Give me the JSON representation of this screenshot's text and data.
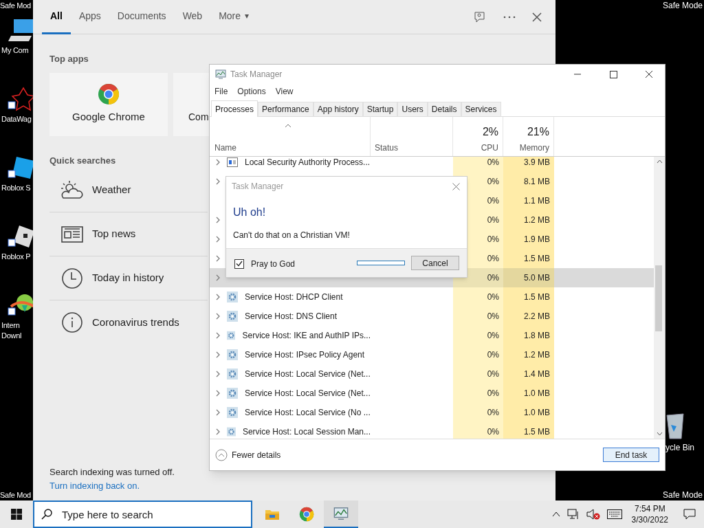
{
  "desktop": {
    "corner_labels": [
      "Safe Mod",
      "Safe Mode",
      "Safe Mod",
      "Safe Mode"
    ],
    "icons": [
      {
        "kind": "computer",
        "label": "My Com"
      },
      {
        "kind": "datawag",
        "label": "DataWag"
      },
      {
        "kind": "studio",
        "label": "Roblox S"
      },
      {
        "kind": "player",
        "label": "Roblox P"
      },
      {
        "kind": "download",
        "label": "Intern Downl"
      }
    ],
    "recycle_bin": "ycle Bin"
  },
  "search_panel": {
    "tabs": [
      {
        "label": "All",
        "selected": true
      },
      {
        "label": "Apps",
        "selected": false
      },
      {
        "label": "Documents",
        "selected": false
      },
      {
        "label": "Web",
        "selected": false
      },
      {
        "label": "More",
        "selected": false
      }
    ],
    "more_caret": "▾",
    "top_apps_heading": "Top apps",
    "top_apps": [
      {
        "kind": "chrome",
        "label": "Google Chrome"
      },
      {
        "kind": "other",
        "label": "Com"
      }
    ],
    "quick_searches_heading": "Quick searches",
    "quick_searches": [
      {
        "kind": "weather",
        "label": "Weather"
      },
      {
        "kind": "news",
        "label": "Top news"
      },
      {
        "kind": "history",
        "label": "Today in history"
      },
      {
        "kind": "info",
        "label": "Coronavirus trends"
      }
    ],
    "indexing_notice": "Search indexing was turned off.",
    "indexing_link": "Turn indexing back on."
  },
  "task_manager": {
    "title": "Task Manager",
    "menu": [
      "File",
      "Options",
      "View"
    ],
    "tabs": [
      {
        "label": "Processes",
        "selected": true
      },
      {
        "label": "Performance",
        "selected": false
      },
      {
        "label": "App history",
        "selected": false
      },
      {
        "label": "Startup",
        "selected": false
      },
      {
        "label": "Users",
        "selected": false
      },
      {
        "label": "Details",
        "selected": false
      },
      {
        "label": "Services",
        "selected": false
      }
    ],
    "columns": {
      "name": "Name",
      "status": "Status",
      "cpu_total": "2%",
      "cpu": "CPU",
      "memory_total": "21%",
      "memory": "Memory"
    },
    "rows": [
      {
        "name": "Local Security Authority Process...",
        "kind": "app",
        "expandable": true,
        "cpu": "0%",
        "memory": "3.9 MB",
        "selected": false
      },
      {
        "expandable": true,
        "cpu": "0%",
        "memory": "8.1 MB",
        "selected": false
      },
      {
        "expandable": false,
        "cpu": "0%",
        "memory": "1.1 MB",
        "selected": false
      },
      {
        "expandable": true,
        "cpu": "0%",
        "memory": "1.2 MB",
        "selected": false
      },
      {
        "expandable": true,
        "cpu": "0%",
        "memory": "1.9 MB",
        "selected": false
      },
      {
        "expandable": true,
        "cpu": "0%",
        "memory": "1.5 MB",
        "selected": false
      },
      {
        "expandable": true,
        "cpu": "0%",
        "memory": "5.0 MB",
        "selected": true
      },
      {
        "name": "Service Host: DHCP Client",
        "kind": "gear",
        "expandable": true,
        "cpu": "0%",
        "memory": "1.5 MB",
        "selected": false
      },
      {
        "name": "Service Host: DNS Client",
        "kind": "gear",
        "expandable": true,
        "cpu": "0%",
        "memory": "2.2 MB",
        "selected": false
      },
      {
        "name": "Service Host: IKE and AuthIP IPs...",
        "kind": "gear",
        "expandable": true,
        "cpu": "0%",
        "memory": "1.8 MB",
        "selected": false
      },
      {
        "name": "Service Host: IPsec Policy Agent",
        "kind": "gear",
        "expandable": true,
        "cpu": "0%",
        "memory": "1.2 MB",
        "selected": false
      },
      {
        "name": "Service Host: Local Service (Net...",
        "kind": "gear",
        "expandable": true,
        "cpu": "0%",
        "memory": "1.4 MB",
        "selected": false
      },
      {
        "name": "Service Host: Local Service (Net...",
        "kind": "gear",
        "expandable": true,
        "cpu": "0%",
        "memory": "1.0 MB",
        "selected": false
      },
      {
        "name": "Service Host: Local Service (No ...",
        "kind": "gear",
        "expandable": true,
        "cpu": "0%",
        "memory": "1.0 MB",
        "selected": false
      },
      {
        "name": "Service Host: Local Session Man...",
        "kind": "gear",
        "expandable": true,
        "cpu": "0%",
        "memory": "1.5 MB",
        "selected": false
      }
    ],
    "fewer_details": "Fewer details",
    "end_task": "End task"
  },
  "dialog": {
    "title": "Task Manager",
    "heading": "Uh oh!",
    "message": "Can't do that on a Christian VM!",
    "checkbox": {
      "label": "Pray to God",
      "checked": true
    },
    "cancel": "Cancel"
  },
  "taskbar": {
    "search_placeholder": "Type here to search",
    "time": "7:54 PM",
    "date": "3/30/2022"
  }
}
